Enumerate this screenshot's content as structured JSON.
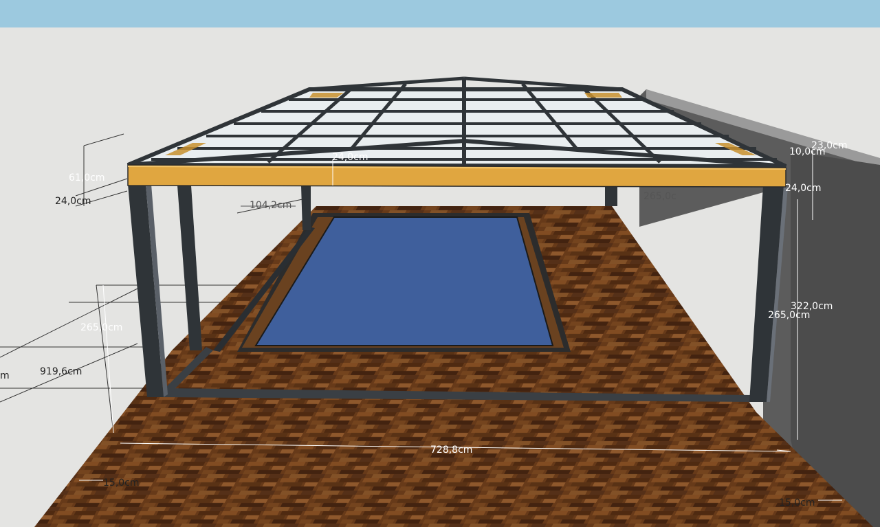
{
  "viewport": {
    "sky_color": "#9cc9df",
    "ground_color": "#e4e4e2",
    "deck_color": "#6b3d1c",
    "pool_color": "#3f5f9c",
    "beam_color": "#e0a640",
    "steel_color": "#2f3438",
    "wall_color": "#5c5c5c"
  },
  "dimensions": {
    "d_61": "61,0cm",
    "d_24_left": "24,0cm",
    "d_24_beam": "24,0cm",
    "d_104": "104,2cm",
    "d_265_back": "265,0c",
    "d_23": "23,0cm",
    "d_10": "10,0cm",
    "d_24_right": "24,0cm",
    "d_322": "322,0cm",
    "d_265_right": "265,0cm",
    "d_265_left": "265,0cm",
    "d_919": "919,6cm",
    "d_m": "m",
    "d_728": "728,8cm",
    "d_15_left": "15,0cm",
    "d_15_right": "15,0cm"
  }
}
